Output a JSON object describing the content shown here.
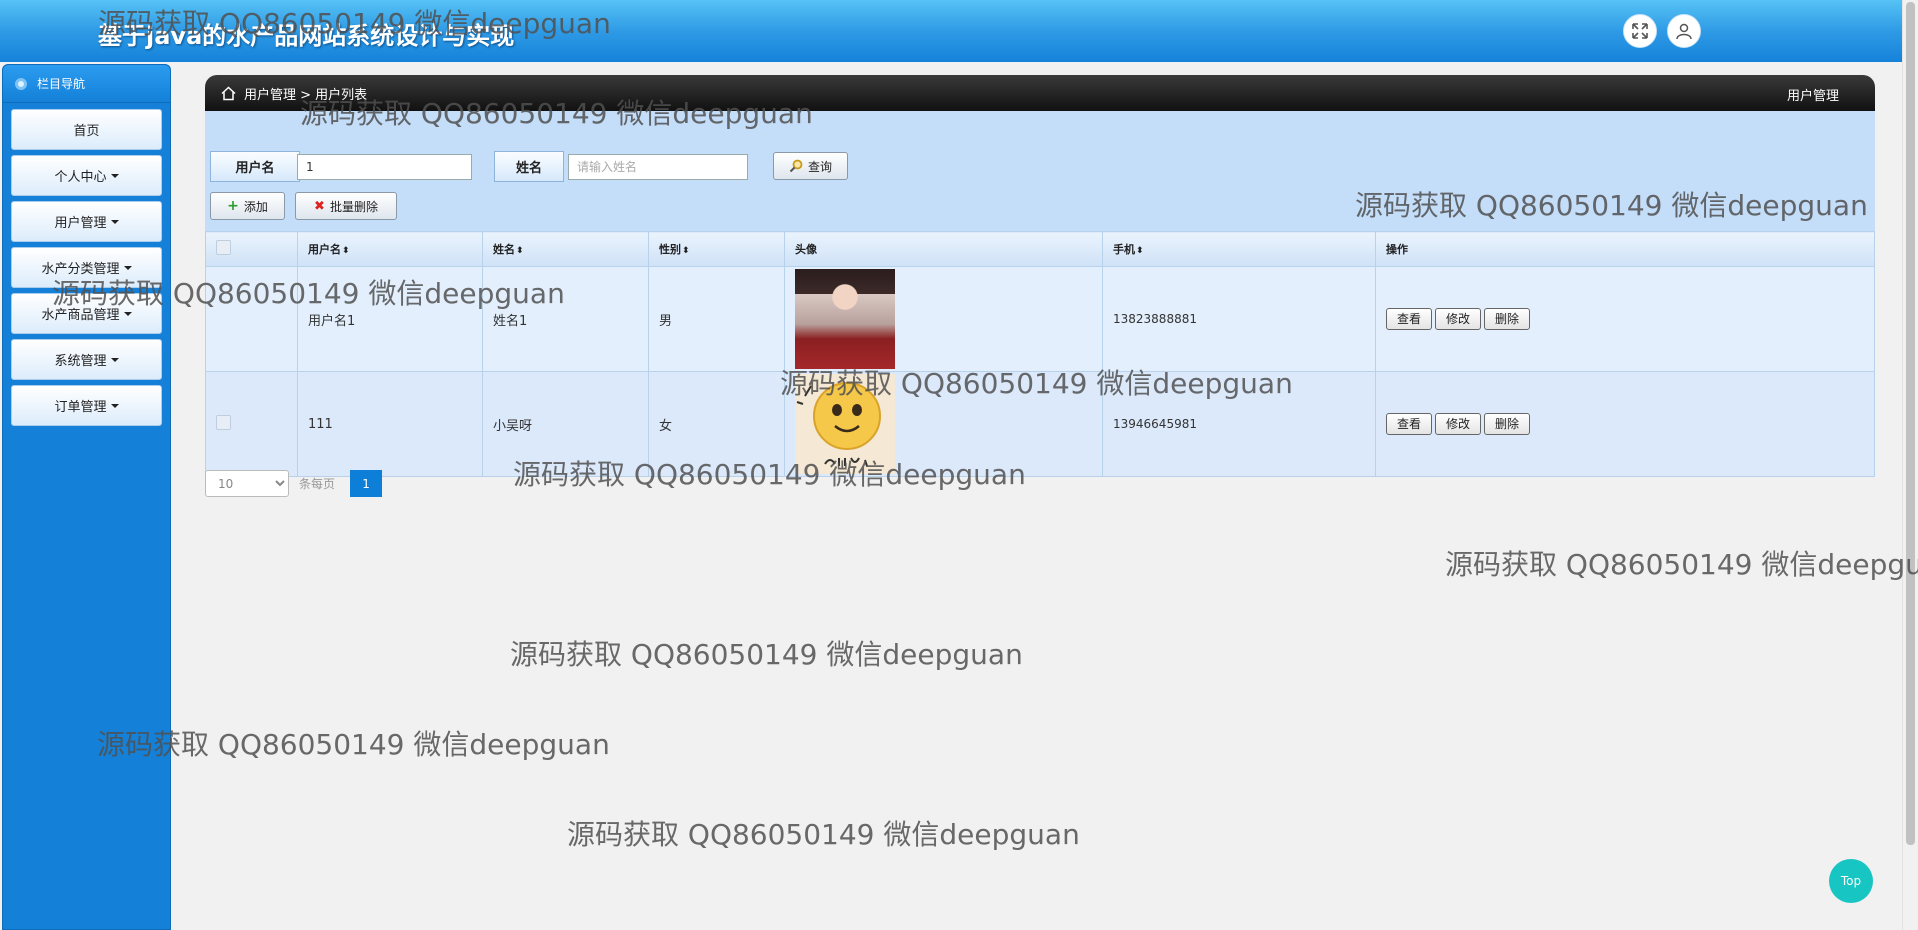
{
  "header": {
    "app_title": "基于java的水产品网站系统设计与实现",
    "fullscreen_icon": "expand-icon",
    "user_icon": "user-icon"
  },
  "sidebar": {
    "title": "栏目导航",
    "items": [
      {
        "label": "首页",
        "has_caret": false
      },
      {
        "label": "个人中心",
        "has_caret": true
      },
      {
        "label": "用户管理",
        "has_caret": true
      },
      {
        "label": "水产分类管理",
        "has_caret": true
      },
      {
        "label": "水产商品管理",
        "has_caret": true
      },
      {
        "label": "系统管理",
        "has_caret": true
      },
      {
        "label": "订单管理",
        "has_caret": true
      }
    ]
  },
  "breadcrumb": {
    "path": "用户管理 > 用户列表",
    "right": "用户管理"
  },
  "filters": {
    "username_label": "用户名",
    "username_value": "1",
    "name_label": "姓名",
    "name_placeholder": "请输入姓名",
    "search_button": "查询"
  },
  "actions": {
    "add": "添加",
    "batch_delete": "批量删除"
  },
  "table": {
    "columns": [
      "用户名",
      "姓名",
      "性别",
      "头像",
      "手机",
      "操作"
    ],
    "sortable": [
      true,
      true,
      true,
      false,
      true,
      false
    ],
    "rows": [
      {
        "username": "用户名1",
        "name": "姓名1",
        "gender": "男",
        "avatar": "portrait-photo",
        "phone": "13823888881"
      },
      {
        "username": "111",
        "name": "小吴呀",
        "gender": "女",
        "avatar": "smile-emoji-image",
        "phone": "13946645981"
      }
    ],
    "row_actions": [
      "查看",
      "修改",
      "删除"
    ]
  },
  "pagination": {
    "page_size": "10",
    "page_size_suffix": "条每页",
    "current_page": "1"
  },
  "top_button": "Top",
  "watermark": "源码获取 QQ86050149 微信deepguan",
  "colors": {
    "header_blue": "#1582d9",
    "sidebar_blue": "#1480d8",
    "table_bg": "#dbeafb",
    "accent_teal": "#17c5c3"
  }
}
